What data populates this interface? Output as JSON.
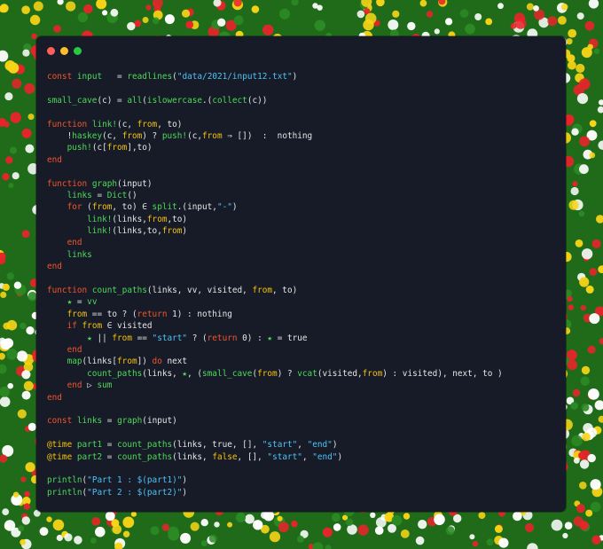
{
  "window": {
    "controls": [
      "close",
      "minimize",
      "maximize"
    ]
  },
  "colors": {
    "background_green": "#1f6b1a",
    "window_bg": "#161b27",
    "keyword": "#f2552c",
    "function": "#4fd95a",
    "string": "#4fc3f7",
    "variable": "#f4c20d",
    "text": "#e6e6e6"
  },
  "code_lines": [
    [
      {
        "t": "const",
        "c": "kw"
      },
      {
        "t": " ",
        "c": "plain"
      },
      {
        "t": "input",
        "c": "fn"
      },
      {
        "t": "   = ",
        "c": "plain"
      },
      {
        "t": "readlines",
        "c": "fn"
      },
      {
        "t": "(",
        "c": "plain"
      },
      {
        "t": "\"data/2021/input12.txt\"",
        "c": "str"
      },
      {
        "t": ")",
        "c": "plain"
      }
    ],
    [],
    [
      {
        "t": "small_cave",
        "c": "fn"
      },
      {
        "t": "(c) = ",
        "c": "plain"
      },
      {
        "t": "all",
        "c": "fn"
      },
      {
        "t": "(",
        "c": "plain"
      },
      {
        "t": "islowercase",
        "c": "fn"
      },
      {
        "t": ".(",
        "c": "plain"
      },
      {
        "t": "collect",
        "c": "fn"
      },
      {
        "t": "(c))",
        "c": "plain"
      }
    ],
    [],
    [
      {
        "t": "function",
        "c": "kw"
      },
      {
        "t": " ",
        "c": "plain"
      },
      {
        "t": "link!",
        "c": "fn"
      },
      {
        "t": "(c, ",
        "c": "plain"
      },
      {
        "t": "from",
        "c": "var"
      },
      {
        "t": ", to)",
        "c": "plain"
      }
    ],
    [
      {
        "t": "    !",
        "c": "plain"
      },
      {
        "t": "haskey",
        "c": "fn"
      },
      {
        "t": "(c, ",
        "c": "plain"
      },
      {
        "t": "from",
        "c": "var"
      },
      {
        "t": ") ? ",
        "c": "plain"
      },
      {
        "t": "push!",
        "c": "fn"
      },
      {
        "t": "(c,",
        "c": "plain"
      },
      {
        "t": "from",
        "c": "var"
      },
      {
        "t": " ⇒ [])  :  nothing",
        "c": "plain"
      }
    ],
    [
      {
        "t": "    ",
        "c": "plain"
      },
      {
        "t": "push!",
        "c": "fn"
      },
      {
        "t": "(c[",
        "c": "plain"
      },
      {
        "t": "from",
        "c": "var"
      },
      {
        "t": "],to)",
        "c": "plain"
      }
    ],
    [
      {
        "t": "end",
        "c": "kw"
      }
    ],
    [],
    [
      {
        "t": "function",
        "c": "kw"
      },
      {
        "t": " ",
        "c": "plain"
      },
      {
        "t": "graph",
        "c": "fn"
      },
      {
        "t": "(input)",
        "c": "plain"
      }
    ],
    [
      {
        "t": "    ",
        "c": "plain"
      },
      {
        "t": "links",
        "c": "fn"
      },
      {
        "t": " = ",
        "c": "plain"
      },
      {
        "t": "Dict",
        "c": "fn"
      },
      {
        "t": "()",
        "c": "plain"
      }
    ],
    [
      {
        "t": "    ",
        "c": "plain"
      },
      {
        "t": "for",
        "c": "kw"
      },
      {
        "t": " (",
        "c": "plain"
      },
      {
        "t": "from",
        "c": "var"
      },
      {
        "t": ", to) ∈ ",
        "c": "plain"
      },
      {
        "t": "split",
        "c": "fn"
      },
      {
        "t": ".(input,",
        "c": "plain"
      },
      {
        "t": "\"-\"",
        "c": "str"
      },
      {
        "t": ")",
        "c": "plain"
      }
    ],
    [
      {
        "t": "        ",
        "c": "plain"
      },
      {
        "t": "link!",
        "c": "fn"
      },
      {
        "t": "(links,",
        "c": "plain"
      },
      {
        "t": "from",
        "c": "var"
      },
      {
        "t": ",to)",
        "c": "plain"
      }
    ],
    [
      {
        "t": "        ",
        "c": "plain"
      },
      {
        "t": "link!",
        "c": "fn"
      },
      {
        "t": "(links,to,",
        "c": "plain"
      },
      {
        "t": "from",
        "c": "var"
      },
      {
        "t": ")",
        "c": "plain"
      }
    ],
    [
      {
        "t": "    ",
        "c": "plain"
      },
      {
        "t": "end",
        "c": "kw"
      }
    ],
    [
      {
        "t": "    ",
        "c": "plain"
      },
      {
        "t": "links",
        "c": "fn"
      }
    ],
    [
      {
        "t": "end",
        "c": "kw"
      }
    ],
    [],
    [
      {
        "t": "function",
        "c": "kw"
      },
      {
        "t": " ",
        "c": "plain"
      },
      {
        "t": "count_paths",
        "c": "fn"
      },
      {
        "t": "(links, vv, visited, ",
        "c": "plain"
      },
      {
        "t": "from",
        "c": "var"
      },
      {
        "t": ", to)",
        "c": "plain"
      }
    ],
    [
      {
        "t": "    ",
        "c": "plain"
      },
      {
        "t": "★",
        "c": "fn"
      },
      {
        "t": " = ",
        "c": "plain"
      },
      {
        "t": "vv",
        "c": "fn"
      }
    ],
    [
      {
        "t": "    ",
        "c": "plain"
      },
      {
        "t": "from",
        "c": "var"
      },
      {
        "t": " == to ? (",
        "c": "plain"
      },
      {
        "t": "return",
        "c": "kw"
      },
      {
        "t": " 1) : nothing",
        "c": "plain"
      }
    ],
    [
      {
        "t": "    ",
        "c": "plain"
      },
      {
        "t": "if",
        "c": "kw"
      },
      {
        "t": " ",
        "c": "plain"
      },
      {
        "t": "from",
        "c": "var"
      },
      {
        "t": " ∈ visited",
        "c": "plain"
      }
    ],
    [
      {
        "t": "        ",
        "c": "plain"
      },
      {
        "t": "★",
        "c": "fn"
      },
      {
        "t": " || ",
        "c": "plain"
      },
      {
        "t": "from",
        "c": "var"
      },
      {
        "t": " == ",
        "c": "plain"
      },
      {
        "t": "\"start\"",
        "c": "str"
      },
      {
        "t": " ? (",
        "c": "plain"
      },
      {
        "t": "return",
        "c": "kw"
      },
      {
        "t": " 0) : ",
        "c": "plain"
      },
      {
        "t": "★",
        "c": "fn"
      },
      {
        "t": " = true",
        "c": "plain"
      }
    ],
    [
      {
        "t": "    ",
        "c": "plain"
      },
      {
        "t": "end",
        "c": "kw"
      }
    ],
    [
      {
        "t": "    ",
        "c": "plain"
      },
      {
        "t": "map",
        "c": "fn"
      },
      {
        "t": "(links[",
        "c": "plain"
      },
      {
        "t": "from",
        "c": "var"
      },
      {
        "t": "]) ",
        "c": "plain"
      },
      {
        "t": "do",
        "c": "kw"
      },
      {
        "t": " next",
        "c": "plain"
      }
    ],
    [
      {
        "t": "        ",
        "c": "plain"
      },
      {
        "t": "count_paths",
        "c": "fn"
      },
      {
        "t": "(links, ",
        "c": "plain"
      },
      {
        "t": "★",
        "c": "fn"
      },
      {
        "t": ", (",
        "c": "plain"
      },
      {
        "t": "small_cave",
        "c": "fn"
      },
      {
        "t": "(",
        "c": "plain"
      },
      {
        "t": "from",
        "c": "var"
      },
      {
        "t": ") ? ",
        "c": "plain"
      },
      {
        "t": "vcat",
        "c": "fn"
      },
      {
        "t": "(visited,",
        "c": "plain"
      },
      {
        "t": "from",
        "c": "var"
      },
      {
        "t": ") : visited), next, to )",
        "c": "plain"
      }
    ],
    [
      {
        "t": "    ",
        "c": "plain"
      },
      {
        "t": "end",
        "c": "kw"
      },
      {
        "t": " ▷ ",
        "c": "plain"
      },
      {
        "t": "sum",
        "c": "fn"
      }
    ],
    [
      {
        "t": "end",
        "c": "kw"
      }
    ],
    [],
    [
      {
        "t": "const",
        "c": "kw"
      },
      {
        "t": " ",
        "c": "plain"
      },
      {
        "t": "links",
        "c": "fn"
      },
      {
        "t": " = ",
        "c": "plain"
      },
      {
        "t": "graph",
        "c": "fn"
      },
      {
        "t": "(input)",
        "c": "plain"
      }
    ],
    [],
    [
      {
        "t": "@time",
        "c": "mac"
      },
      {
        "t": " ",
        "c": "plain"
      },
      {
        "t": "part1",
        "c": "fn"
      },
      {
        "t": " = ",
        "c": "plain"
      },
      {
        "t": "count_paths",
        "c": "fn"
      },
      {
        "t": "(links, true, [], ",
        "c": "plain"
      },
      {
        "t": "\"start\"",
        "c": "str"
      },
      {
        "t": ", ",
        "c": "plain"
      },
      {
        "t": "\"end\"",
        "c": "str"
      },
      {
        "t": ")",
        "c": "plain"
      }
    ],
    [
      {
        "t": "@time",
        "c": "mac"
      },
      {
        "t": " ",
        "c": "plain"
      },
      {
        "t": "part2",
        "c": "fn"
      },
      {
        "t": " = ",
        "c": "plain"
      },
      {
        "t": "count_paths",
        "c": "fn"
      },
      {
        "t": "(links, ",
        "c": "plain"
      },
      {
        "t": "false",
        "c": "var"
      },
      {
        "t": ", [], ",
        "c": "plain"
      },
      {
        "t": "\"start\"",
        "c": "str"
      },
      {
        "t": ", ",
        "c": "plain"
      },
      {
        "t": "\"end\"",
        "c": "str"
      },
      {
        "t": ")",
        "c": "plain"
      }
    ],
    [],
    [
      {
        "t": "println",
        "c": "fn"
      },
      {
        "t": "(",
        "c": "plain"
      },
      {
        "t": "\"Part 1 : $(part1)\"",
        "c": "str"
      },
      {
        "t": ")",
        "c": "plain"
      }
    ],
    [
      {
        "t": "println",
        "c": "fn"
      },
      {
        "t": "(",
        "c": "plain"
      },
      {
        "t": "\"Part 2 : $(part2)\"",
        "c": "str"
      },
      {
        "t": ")",
        "c": "plain"
      }
    ]
  ]
}
